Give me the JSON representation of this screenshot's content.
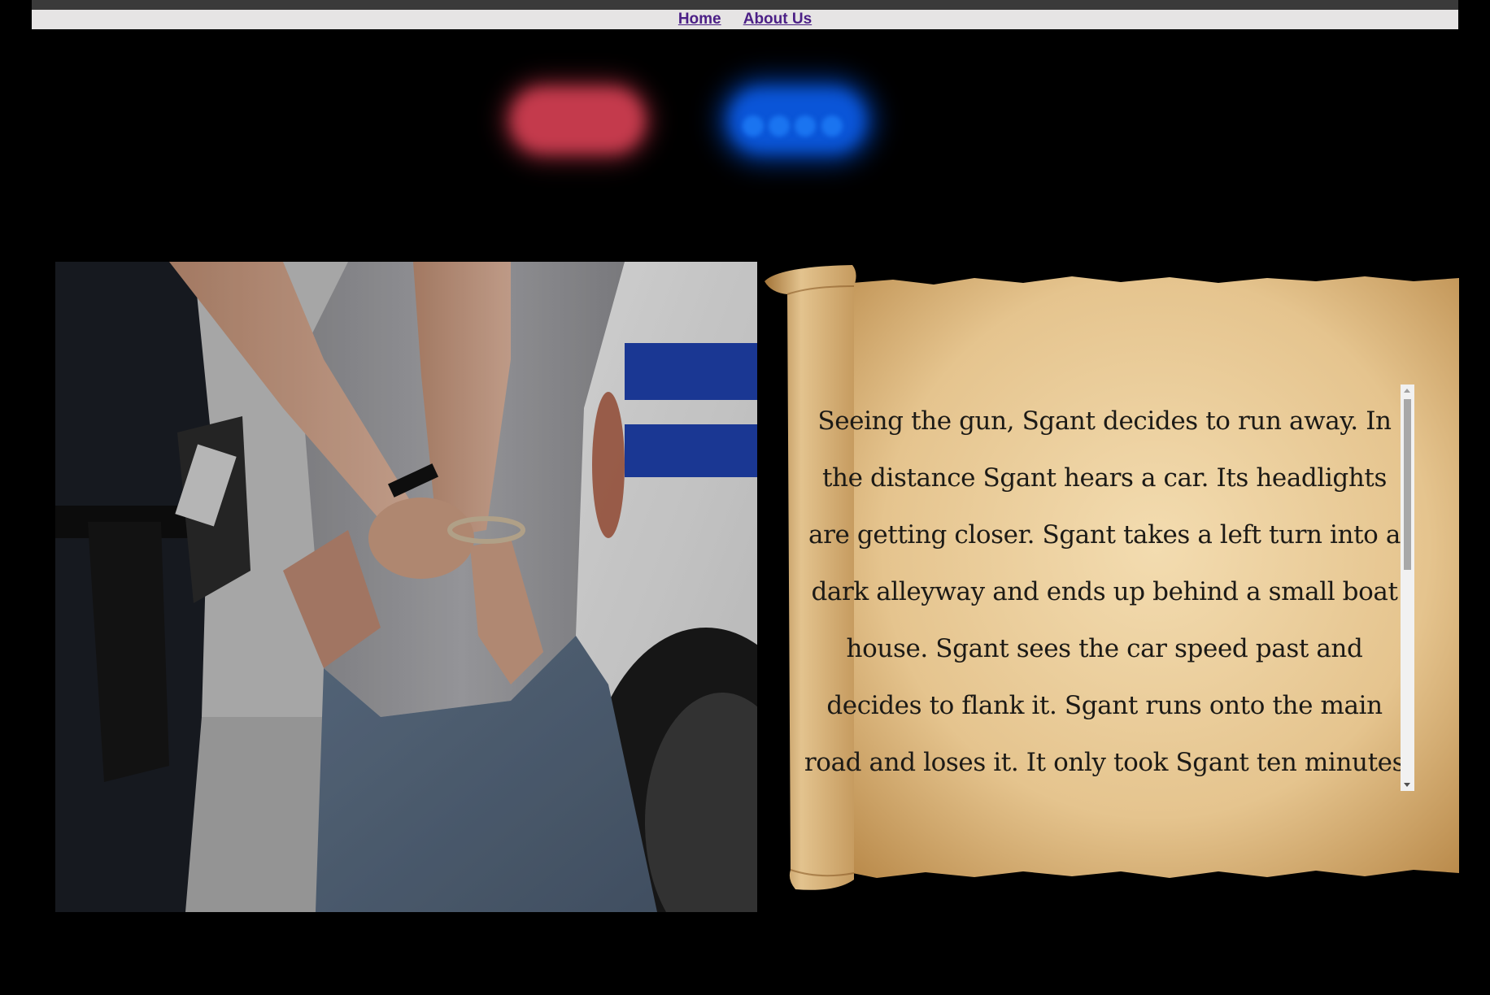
{
  "nav": {
    "links": [
      {
        "label": "Home"
      },
      {
        "label": "About Us"
      }
    ]
  },
  "hero": {
    "siren_colors": {
      "red": "#c43a4c",
      "blue": "#0a55d8"
    }
  },
  "story": {
    "text": "Seeing the gun, Sgant decides to run away. In the distance Sgant hears a car. Its headlights are getting closer. Sgant takes a left turn into a dark alleyway and ends up behind a small boat house. Sgant sees the car speed past and decides to flank it. Sgant runs onto the main road and loses it. It only took Sgant ten minutes to find"
  },
  "colors": {
    "background": "#000000",
    "nav_bar": "#e6e4e4",
    "link": "#4b1f86",
    "parchment": "#e8c998",
    "text": "#1c1a16"
  }
}
